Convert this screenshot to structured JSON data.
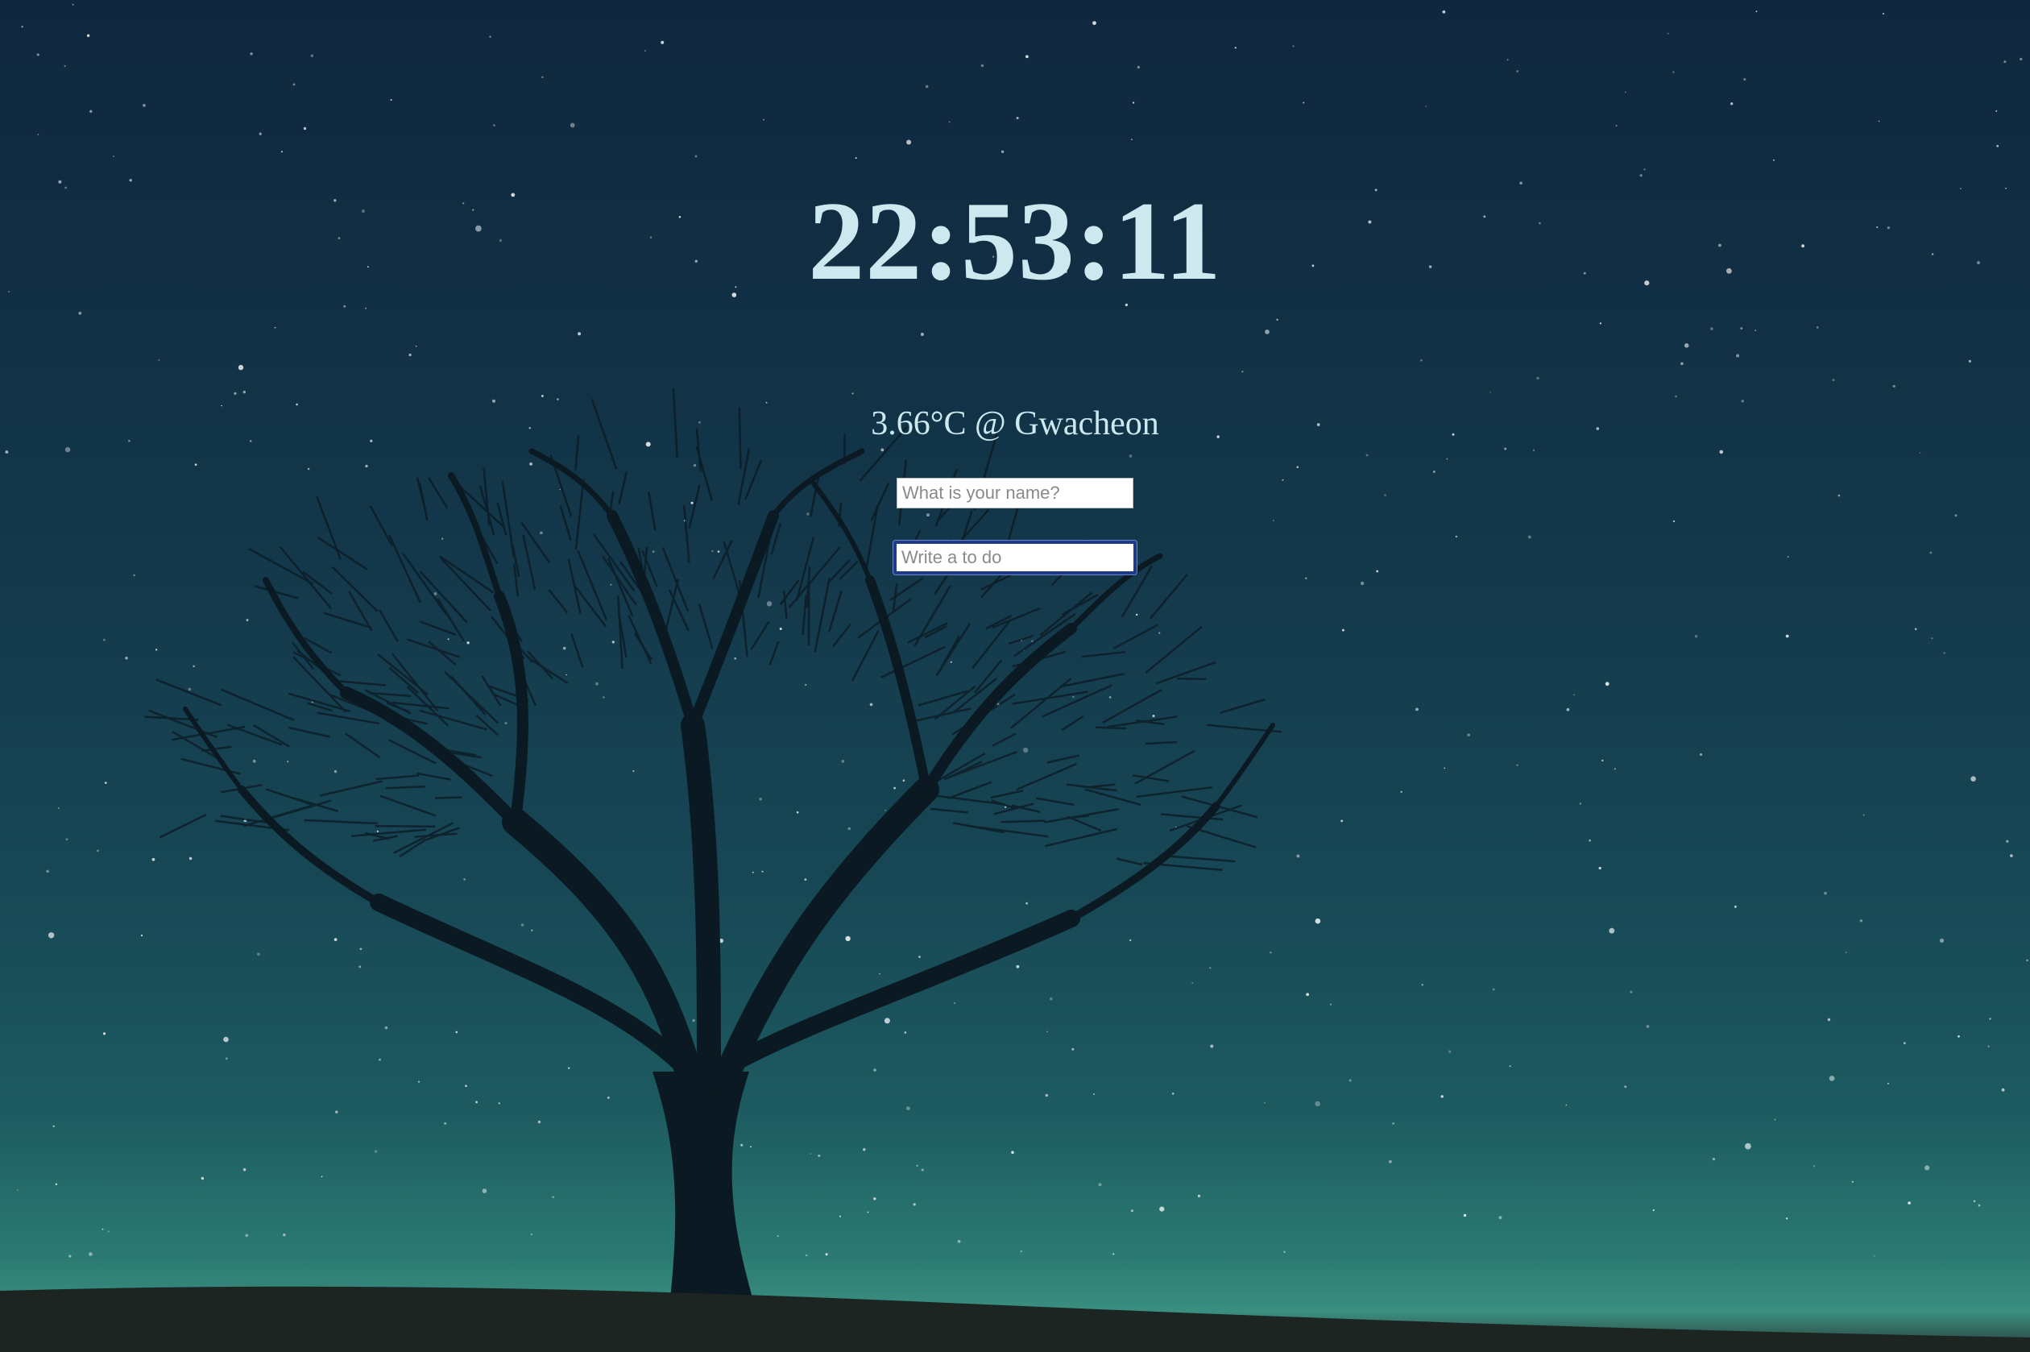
{
  "clock": {
    "time": "22:53:11"
  },
  "weather": {
    "text": "3.66°C @ Gwacheon"
  },
  "login_form": {
    "placeholder": "What is your name?",
    "value": ""
  },
  "todo_form": {
    "placeholder": "Write a to do",
    "value": ""
  },
  "colors": {
    "sky_top": "#10283f",
    "sky_bottom": "#2b7a72",
    "text": "#cde9ef",
    "focus_ring": "#1f3a8a"
  }
}
